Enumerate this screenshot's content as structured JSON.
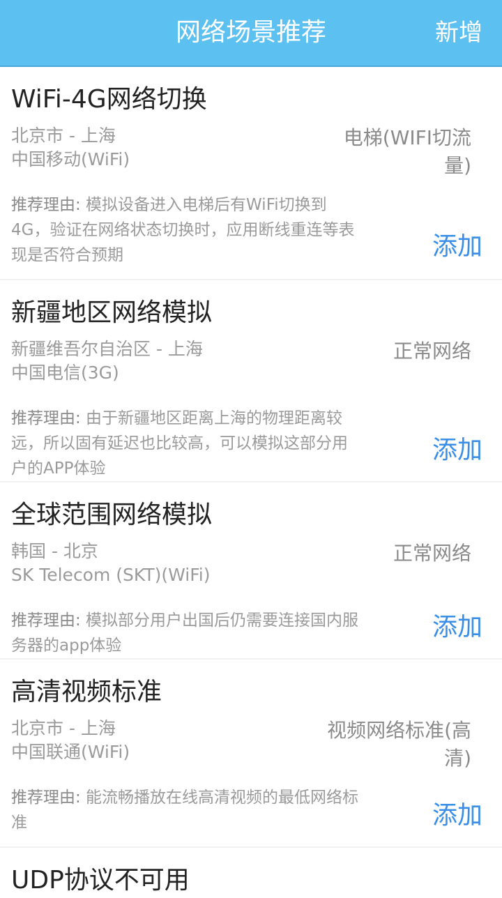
{
  "header": {
    "title": "网络场景推荐",
    "add_label": "新增"
  },
  "items": [
    {
      "title": "WiFi-4G网络切换",
      "route": "北京市 - 上海",
      "carrier": "中国移动(WiFi)",
      "scene": "电梯(WIFI切流量)",
      "reason_label": "推荐理由:",
      "reason": " 模拟设备进入电梯后有WiFi切换到4G，验证在网络状态切换时，应用断线重连等表现是否符合预期",
      "add_label": "添加"
    },
    {
      "title": "新疆地区网络模拟",
      "route": "新疆维吾尔自治区 - 上海",
      "carrier": "中国电信(3G)",
      "scene": "正常网络",
      "reason_label": "推荐理由:",
      "reason": " 由于新疆地区距离上海的物理距离较远，所以固有延迟也比较高，可以模拟这部分用户的APP体验",
      "add_label": "添加"
    },
    {
      "title": "全球范围网络模拟",
      "route": "韩国 - 北京",
      "carrier": "SK Telecom (SKT)(WiFi)",
      "scene": "正常网络",
      "reason_label": "推荐理由:",
      "reason": " 模拟部分用户出国后仍需要连接国内服务器的app体验",
      "add_label": "添加"
    },
    {
      "title": "高清视频标准",
      "route": "北京市 - 上海",
      "carrier": "中国联通(WiFi)",
      "scene": "视频网络标准(高清)",
      "reason_label": "推荐理由:",
      "reason": " 能流畅播放在线高清视频的最低网络标准",
      "add_label": "添加"
    },
    {
      "title": "UDP协议不可用"
    }
  ]
}
